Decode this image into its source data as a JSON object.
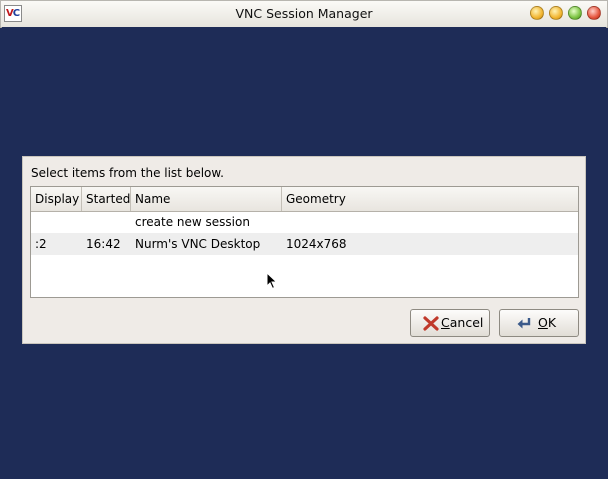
{
  "window": {
    "title": "VNC Session Manager",
    "app_icon_text_v": "V",
    "app_icon_text_c": "C"
  },
  "dialog": {
    "prompt": "Select items from the list below.",
    "columns": [
      "Display",
      "Started",
      "Name",
      "Geometry"
    ],
    "rows": [
      {
        "display": "",
        "started": "",
        "name": "create new session",
        "geometry": ""
      },
      {
        "display": ":2",
        "started": "16:42",
        "name": "Nurm's VNC Desktop",
        "geometry": "1024x768"
      }
    ],
    "cancel_mnemonic": "C",
    "cancel_rest": "ancel",
    "ok_mnemonic": "O",
    "ok_rest": "K"
  },
  "colors": {
    "desktop": "#1e2c57",
    "dialog_bg": "#efebe7",
    "cancel_icon": "#c0392b",
    "ok_icon": "#3b5a8a"
  },
  "icons": {
    "shade": "shade-icon",
    "minimize": "minimize-icon",
    "maximize": "maximize-icon",
    "close": "close-icon",
    "cancel": "cancel-x-icon",
    "ok": "ok-enter-arrow-icon",
    "cursor": "mouse-pointer-icon"
  }
}
